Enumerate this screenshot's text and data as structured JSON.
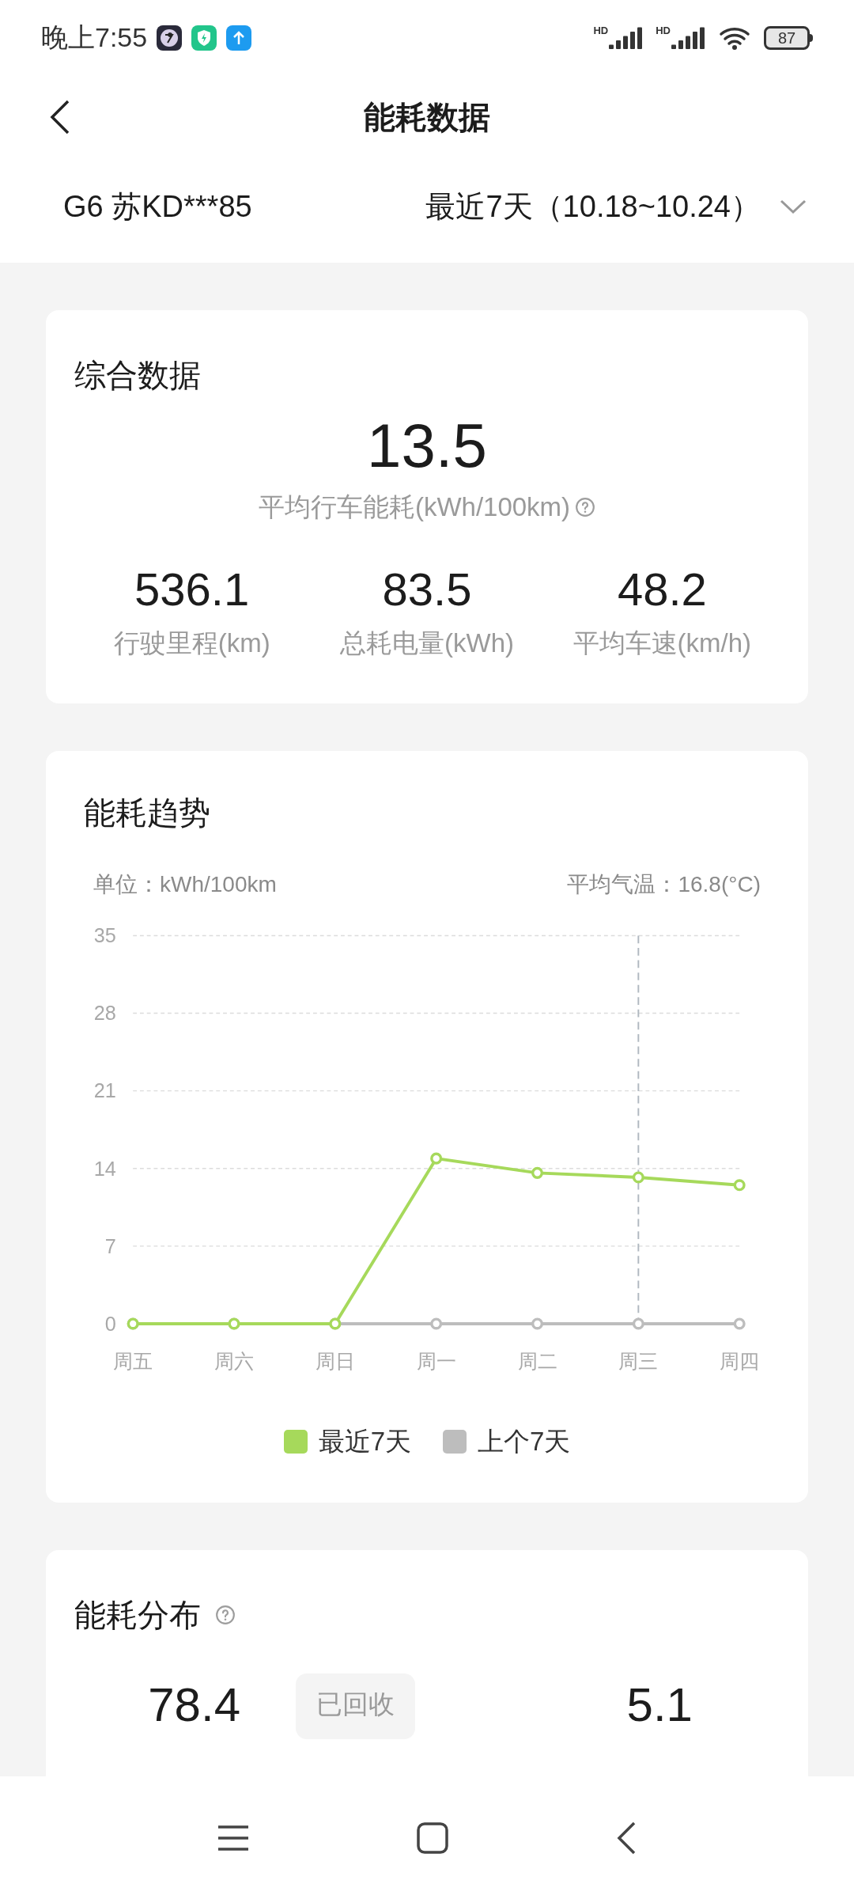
{
  "status_bar": {
    "time": "晚上7:55",
    "signal_labels": [
      "HD",
      "HD"
    ],
    "battery": "87"
  },
  "header": {
    "title": "能耗数据"
  },
  "selector": {
    "vehicle": "G6 苏KD***85",
    "period": "最近7天（10.18~10.24）"
  },
  "summary": {
    "title": "综合数据",
    "main_value": "13.5",
    "main_label": "平均行车能耗(kWh/100km)",
    "stats": [
      {
        "value": "536.1",
        "label": "行驶里程(km)"
      },
      {
        "value": "83.5",
        "label": "总耗电量(kWh)"
      },
      {
        "value": "48.2",
        "label": "平均车速(km/h)"
      }
    ]
  },
  "trend": {
    "title": "能耗趋势",
    "unit": "单位：kWh/100km",
    "temperature": "平均气温：16.8(°C)",
    "chart_data": {
      "type": "line",
      "categories": [
        "周五",
        "周六",
        "周日",
        "周一",
        "周二",
        "周三",
        "周四"
      ],
      "series": [
        {
          "name": "最近7天",
          "color": "#a6d95b",
          "marker": "circle",
          "values": [
            0,
            0,
            0,
            14.9,
            13.6,
            13.2,
            12.5
          ]
        },
        {
          "name": "上个7天",
          "color": "#bdbdbd",
          "marker": "circle",
          "values": [
            0,
            0,
            0,
            0,
            0,
            0,
            0
          ]
        }
      ],
      "ylim": [
        0,
        35
      ],
      "yticks": [
        0,
        7,
        14,
        21,
        28,
        35
      ],
      "grid": true,
      "ref_lines": [
        {
          "axis": "x",
          "value": "周三"
        }
      ]
    }
  },
  "distribution": {
    "title": "能耗分布",
    "left_value": "78.4",
    "tag": "已回收",
    "right_value": "5.1"
  }
}
